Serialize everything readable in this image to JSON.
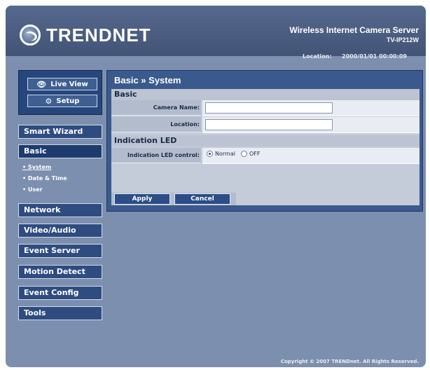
{
  "header": {
    "logo_text": "TRENDNET",
    "product_title": "Wireless Internet Camera Server",
    "product_model": "TV-IP212W",
    "location_label": "Location:",
    "datetime": "2000/01/01 00:00:09"
  },
  "mode_buttons": {
    "live_view": "Live View",
    "setup": "Setup"
  },
  "nav": {
    "smart_wizard": "Smart Wizard",
    "basic": "Basic",
    "basic_sub": [
      "System",
      "Date & Time",
      "User"
    ],
    "network": "Network",
    "video_audio": "Video/Audio",
    "event_server": "Event Server",
    "motion_detect": "Motion Detect",
    "event_config": "Event Config",
    "tools": "Tools"
  },
  "main": {
    "title": "Basic » System",
    "section_basic": "Basic",
    "camera_name_label": "Camera Name:",
    "camera_name_value": "",
    "location_label": "Location:",
    "location_value": "",
    "section_led": "Indication LED",
    "led_label": "Indication LED control:",
    "led_options": [
      "Normal",
      "OFF"
    ],
    "led_selected": "Normal",
    "apply": "Apply",
    "cancel": "Cancel"
  },
  "footer": {
    "copyright": "Copyright © 2007 TRENDnet. All Rights Reserved."
  },
  "colors": {
    "background": "#7d8fae",
    "panel_dark": "#3a5a8e",
    "button_blue": "#2e4c80"
  }
}
